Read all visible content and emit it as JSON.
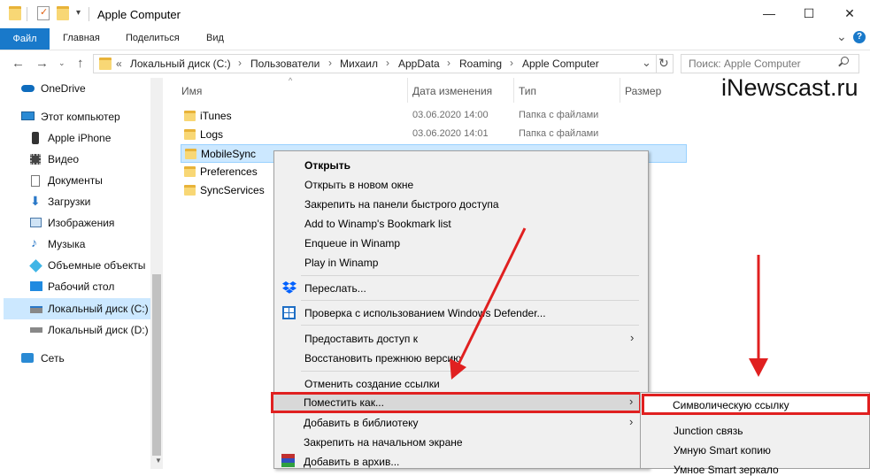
{
  "window": {
    "title": "Apple Computer",
    "minimize": "—",
    "maximize": "☐",
    "close": "✕"
  },
  "ribbon": {
    "tabs": [
      "Файл",
      "Главная",
      "Поделиться",
      "Вид"
    ],
    "expand": "⌄",
    "help": "?"
  },
  "address": {
    "prefix": "«",
    "crumbs": [
      "Локальный диск (C:)",
      "Пользователи",
      "Михаил",
      "AppData",
      "Roaming",
      "Apple Computer"
    ],
    "dropdown": "⌄",
    "refresh": "↻"
  },
  "search": {
    "placeholder": "Поиск: Apple Computer"
  },
  "sidebar": {
    "items": [
      "OneDrive",
      "Этот компьютер",
      "Apple iPhone",
      "Видео",
      "Документы",
      "Загрузки",
      "Изображения",
      "Музыка",
      "Объемные объекты",
      "Рабочий стол",
      "Локальный диск (C:)",
      "Локальный диск (D:)",
      "Сеть"
    ]
  },
  "columns": {
    "name": "Имя",
    "date": "Дата изменения",
    "type": "Тип",
    "size": "Размер"
  },
  "files": [
    {
      "name": "iTunes",
      "date": "03.06.2020 14:00",
      "type": "Папка с файлами"
    },
    {
      "name": "Logs",
      "date": "03.06.2020 14:01",
      "type": "Папка с файлами"
    },
    {
      "name": "MobileSync",
      "date": "",
      "type": ""
    },
    {
      "name": "Preferences",
      "date": "",
      "type": ""
    },
    {
      "name": "SyncServices",
      "date": "",
      "type": ""
    }
  ],
  "watermark": "iNewscast.ru",
  "context_menu": {
    "items": [
      "Открыть",
      "Открыть в новом окне",
      "Закрепить на панели быстрого доступа",
      "Add to Winamp's Bookmark list",
      "Enqueue in Winamp",
      "Play in Winamp",
      "Переслать...",
      "Проверка с использованием Windows Defender...",
      "Предоставить доступ к",
      "Восстановить прежнюю версию",
      "Отменить создание ссылки",
      "Поместить как...",
      "Добавить в библиотеку",
      "Закрепить на начальном экране",
      "Добавить в архив..."
    ],
    "chevron": "›"
  },
  "submenu": {
    "items": [
      "Символическую ссылку",
      "Junction связь",
      "Умную Smart копию",
      "Умное Smart зеркало"
    ]
  },
  "colors": {
    "accent": "#1979ca",
    "selection": "#cce8ff",
    "highlight_border": "#e02020",
    "arrow": "#e02020"
  }
}
